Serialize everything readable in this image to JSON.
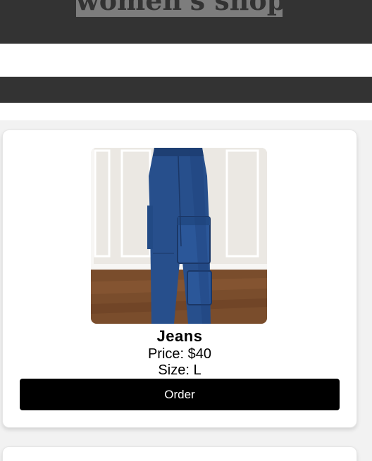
{
  "header": {
    "title": "women's shop"
  },
  "products": [
    {
      "name": "Jeans",
      "price": "Price: $40",
      "size": "Size: L",
      "order_label": "Order",
      "image": "cargo-jeans-photo"
    }
  ],
  "colors": {
    "header_bg": "#333333",
    "page_bg": "#f2f2f2",
    "button_bg": "#000000",
    "button_text": "#ffffff"
  }
}
